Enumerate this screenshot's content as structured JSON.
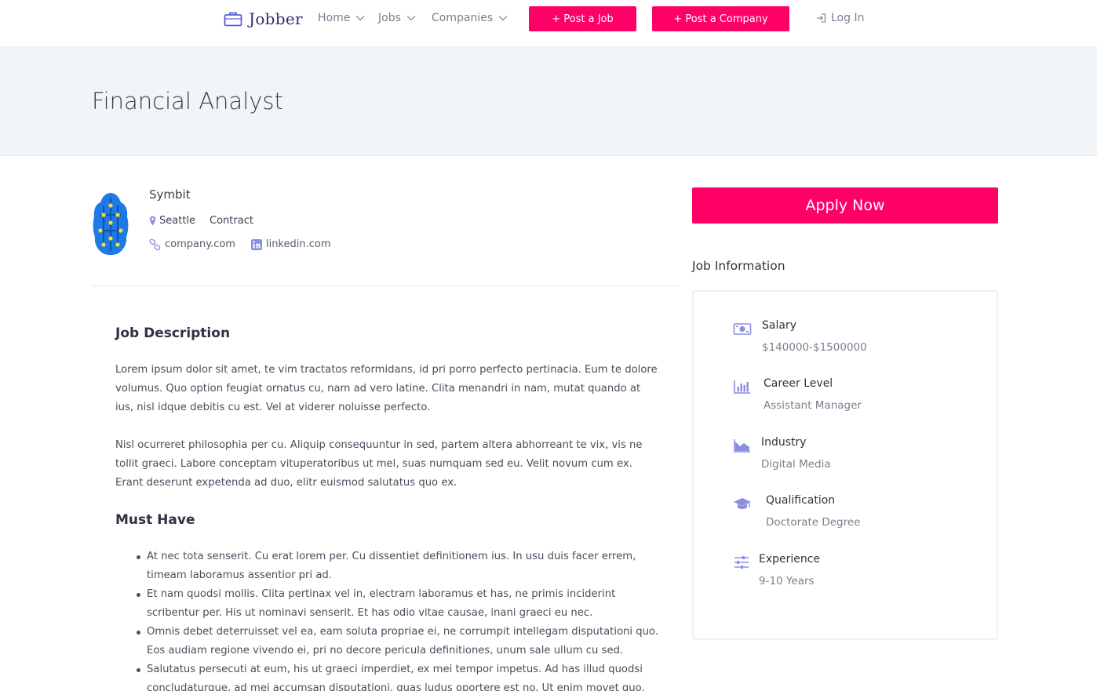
{
  "header": {
    "brand": "Jobber",
    "nav": [
      {
        "label": "Home"
      },
      {
        "label": "Jobs"
      },
      {
        "label": "Companies"
      }
    ],
    "post_job_label": "+ Post a Job",
    "post_company_label": "+ Post a Company",
    "login_label": "Log In"
  },
  "page": {
    "title": "Financial Analyst"
  },
  "company": {
    "name": "Symbit",
    "location": "Seattle",
    "job_type": "Contract",
    "website": "company.com",
    "linkedin": "linkedin.com"
  },
  "description": {
    "heading": "Job Description",
    "paragraphs": [
      "Lorem ipsum dolor sit amet, te vim tractatos reformidans, id pri porro perfecto pertinacia. Eum te dolore volumus. Quo option feugiat ornatus cu, nam ad vero latine. Clita menandri in nam, mutat quando at ius, nisl idque debitis cu est. Vel at viderer noluisse perfecto.",
      "Nisl ocurreret philosophia per cu. Aliquip consequuntur in sed, partem altera abhorreant te vix, vis ne tollit graeci. Labore conceptam vituperatoribus ut mel, suas numquam sed eu. Velit novum cum ex. Erant deserunt expetenda ad duo, elitr euismod salutatus quo ex."
    ],
    "must_have_heading": "Must Have",
    "must_have": [
      "At nec tota senserit. Cu erat lorem per. Cu dissentiet definitionem ius. In usu duis facer errem, timeam laboramus assentior pri ad.",
      "Et nam quodsi mollis. Clita pertinax vel in, electram laboramus et has, ne primis inciderint scribentur per. His ut nominavi senserit. Et has odio vitae causae, inani graeci eu nec.",
      "Omnis debet deterruisset vel ea, eam soluta propriae ei, ne corrumpit intellegam disputationi quo. Eos audiam regione vivendo ei, pri no decore pericula definitiones, unum sale ullum cu sed.",
      "Salutatus persecuti at eum, his ut graeci imperdiet, ex mei tempor impetus. Ad has illud quodsi concludaturque, ad mei accumsan disputationi, quas ludus oportere est no. Ut enim movet quo."
    ]
  },
  "sidebar": {
    "apply_label": "Apply Now",
    "info_title": "Job Information",
    "items": [
      {
        "label": "Salary",
        "value": "$140000-$1500000",
        "icon": "money-icon"
      },
      {
        "label": "Career Level",
        "value": "Assistant Manager",
        "icon": "bar-chart-icon"
      },
      {
        "label": "Industry",
        "value": "Digital Media",
        "icon": "area-chart-icon"
      },
      {
        "label": "Qualification",
        "value": "Doctorate Degree",
        "icon": "graduation-cap-icon"
      },
      {
        "label": "Experience",
        "value": "9-10 Years",
        "icon": "sliders-icon"
      }
    ]
  },
  "colors": {
    "accent": "#ff0066",
    "icon": "#8a8fe0",
    "brand": "#2b2d6e"
  }
}
